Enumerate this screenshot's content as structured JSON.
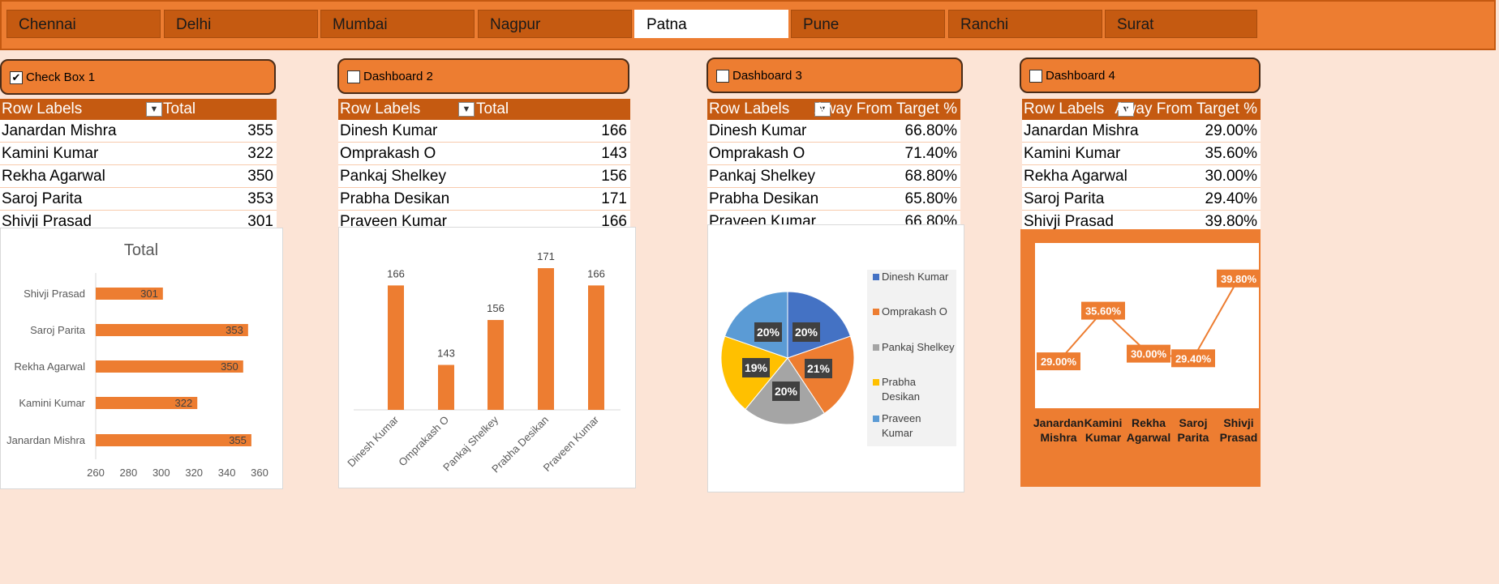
{
  "slicer": {
    "items": [
      "Chennai",
      "Delhi",
      "Mumbai",
      "Nagpur",
      "Patna",
      "Pune",
      "Ranchi",
      "Surat"
    ],
    "selected": "Patna"
  },
  "checkboxes": [
    {
      "label": "Check Box 1",
      "checked": true
    },
    {
      "label": "Dashboard 2",
      "checked": false
    },
    {
      "label": "Dashboard 3",
      "checked": false
    },
    {
      "label": "Dashboard 4",
      "checked": false
    }
  ],
  "tables": [
    {
      "col1": "Row Labels",
      "col2": "Total",
      "rows": [
        {
          "name": "Janardan Mishra",
          "value": "355"
        },
        {
          "name": "Kamini Kumar",
          "value": "322"
        },
        {
          "name": "Rekha Agarwal",
          "value": "350"
        },
        {
          "name": "Saroj Parita",
          "value": "353"
        },
        {
          "name": "Shivji Prasad",
          "value": "301"
        }
      ]
    },
    {
      "col1": "Row Labels",
      "col2": "Total",
      "rows": [
        {
          "name": "Dinesh Kumar",
          "value": "166"
        },
        {
          "name": "Omprakash O",
          "value": "143"
        },
        {
          "name": "Pankaj Shelkey",
          "value": "156"
        },
        {
          "name": "Prabha Desikan",
          "value": "171"
        },
        {
          "name": "Praveen Kumar",
          "value": "166"
        }
      ]
    },
    {
      "col1": "Row Labels",
      "col2": "Away From Target %",
      "rows": [
        {
          "name": "Dinesh Kumar",
          "value": "66.80%"
        },
        {
          "name": "Omprakash O",
          "value": "71.40%"
        },
        {
          "name": "Pankaj Shelkey",
          "value": "68.80%"
        },
        {
          "name": "Prabha Desikan",
          "value": "65.80%"
        },
        {
          "name": "Praveen Kumar",
          "value": "66.80%"
        }
      ]
    },
    {
      "col1": "Row Labels",
      "col2": "Away From Target %",
      "rows": [
        {
          "name": "Janardan Mishra",
          "value": "29.00%"
        },
        {
          "name": "Kamini Kumar",
          "value": "35.60%"
        },
        {
          "name": "Rekha Agarwal",
          "value": "30.00%"
        },
        {
          "name": "Saroj Parita",
          "value": "29.40%"
        },
        {
          "name": "Shivji Prasad",
          "value": "39.80%"
        }
      ]
    }
  ],
  "chart_data": [
    {
      "type": "bar",
      "orientation": "horizontal",
      "title": "Total",
      "categories": [
        "Janardan Mishra",
        "Kamini Kumar",
        "Rekha Agarwal",
        "Saroj Parita",
        "Shivji Prasad"
      ],
      "values": [
        355,
        322,
        350,
        353,
        301
      ],
      "data_labels": [
        "355",
        "322",
        "350",
        "353",
        "301"
      ],
      "xlim": [
        260,
        360
      ],
      "ticks": [
        "260",
        "280",
        "300",
        "320",
        "340",
        "360"
      ],
      "color": "#ed7d31",
      "grid": false
    },
    {
      "type": "bar",
      "orientation": "vertical",
      "categories": [
        "Dinesh Kumar",
        "Omprakash O",
        "Pankaj Shelkey",
        "Prabha Desikan",
        "Praveen Kumar"
      ],
      "values": [
        166,
        143,
        156,
        171,
        166
      ],
      "data_labels": [
        "166",
        "143",
        "156",
        "171",
        "166"
      ],
      "ylim": [
        130,
        175
      ],
      "color": "#ed7d31",
      "grid": false
    },
    {
      "type": "pie",
      "categories": [
        "Dinesh Kumar",
        "Omprakash O",
        "Pankaj Shelkey",
        "Prabha Desikan",
        "Praveen Kumar"
      ],
      "values": [
        66.8,
        71.4,
        68.8,
        65.8,
        66.8
      ],
      "data_labels": [
        "20%",
        "21%",
        "20%",
        "19%",
        "20%"
      ],
      "colors": [
        "#4472c4",
        "#ed7d31",
        "#a5a5a5",
        "#ffc000",
        "#5b9bd5"
      ],
      "legend_labels": [
        "Dinesh Kumar",
        "Omprakash O",
        "Pankaj Shelkey",
        "Prabha Desikan",
        "Praveen Kumar"
      ],
      "legend": "right"
    },
    {
      "type": "line",
      "categories": [
        "Janardan Mishra",
        "Kamini Kumar",
        "Rekha Agarwal",
        "Saroj Parita",
        "Shivji Prasad"
      ],
      "values": [
        29.0,
        35.6,
        30.0,
        29.4,
        39.8
      ],
      "data_labels": [
        "29.00%",
        "35.60%",
        "30.00%",
        "29.40%",
        "39.80%"
      ],
      "color": "#ed7d31",
      "grid": false
    }
  ]
}
